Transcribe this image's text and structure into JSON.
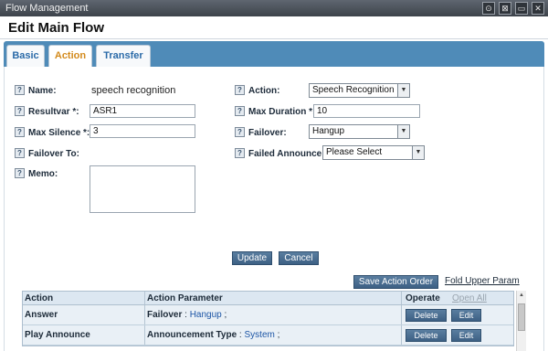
{
  "window": {
    "title": "Flow Management",
    "controls": [
      "⊙",
      "⊠",
      "▭",
      "✕"
    ]
  },
  "page": {
    "title": "Edit Main Flow"
  },
  "tabs": [
    {
      "label": "Basic",
      "active": false
    },
    {
      "label": "Action",
      "active": true
    },
    {
      "label": "Transfer",
      "active": false
    }
  ],
  "form": {
    "name_label": "Name:",
    "name_value": "speech recognition",
    "resultvar_label": "Resultvar *:",
    "resultvar_value": "ASR1",
    "max_silence_label": "Max Silence *:",
    "max_silence_value": "3",
    "failover_to_label": "Failover To:",
    "memo_label": "Memo:",
    "action_label": "Action:",
    "action_value": "Speech Recognition",
    "max_duration_label": "Max Duration *:",
    "max_duration_value": "10",
    "failover_label": "Failover:",
    "failover_value": "Hangup",
    "failed_announce_label": "Failed Announce:",
    "failed_announce_value": "Please Select"
  },
  "buttons": {
    "update": "Update",
    "cancel": "Cancel",
    "save_action_order": "Save Action Order",
    "fold_upper_param": "Fold Upper Param"
  },
  "table": {
    "headers": {
      "action": "Action",
      "param": "Action Parameter",
      "operate": "Operate",
      "open_all": "Open All"
    },
    "rows": [
      {
        "name": "Answer",
        "param_key": "Failover",
        "param_value": "Hangup",
        "delete": "Delete",
        "edit": "Edit"
      },
      {
        "name": "Play Announce",
        "param_key": "Announcement Type",
        "param_value": "System",
        "delete": "Delete",
        "edit": "Edit"
      }
    ]
  },
  "icons": {
    "help": "?"
  }
}
